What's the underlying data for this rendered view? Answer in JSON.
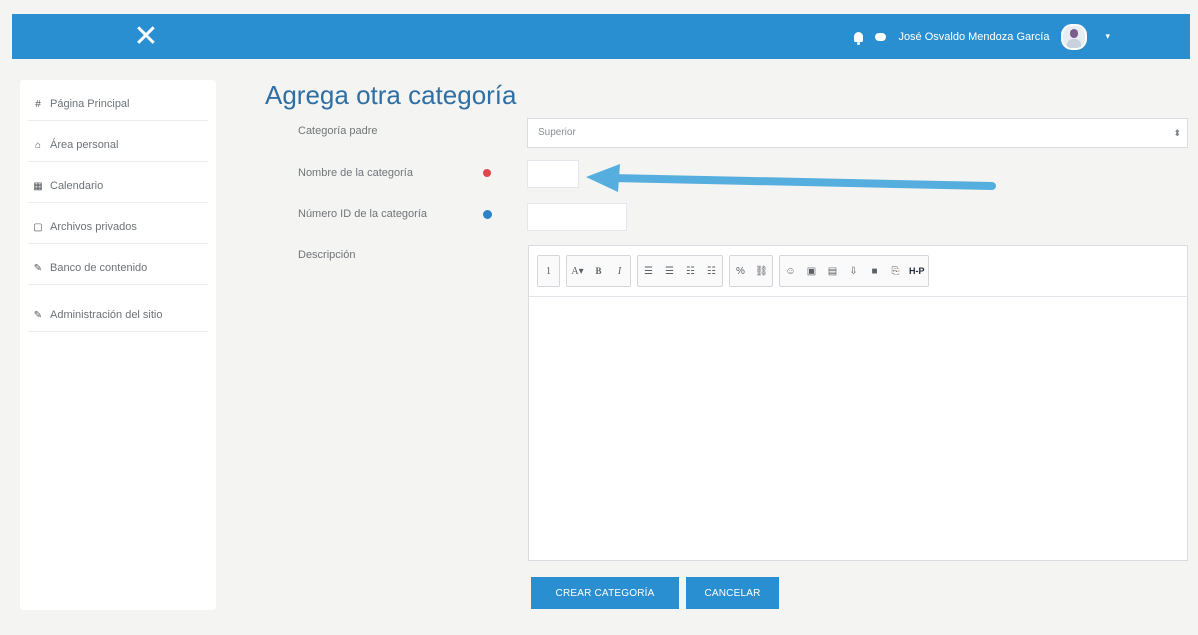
{
  "navbar": {
    "close_symbol": "✕",
    "user_name": "José Osvaldo Mendoza García",
    "caret": "▾",
    "icons": [
      "bell-icon",
      "chat-icon"
    ],
    "accent_color": "#2a8fd0"
  },
  "sidebar": {
    "items": [
      {
        "label": "Página Principal",
        "icon": "home-icon",
        "glyph": "#"
      },
      {
        "label": "Área personal",
        "icon": "dashboard-icon",
        "glyph": "⌂"
      },
      {
        "label": "Calendario",
        "icon": "calendar-icon",
        "glyph": "▦"
      },
      {
        "label": "Archivos privados",
        "icon": "file-icon",
        "glyph": "▢"
      },
      {
        "label": "Banco de contenido",
        "icon": "pencil-icon",
        "glyph": "✎"
      },
      {
        "label": "Administración del sitio",
        "icon": "wrench-icon",
        "glyph": "✎"
      }
    ]
  },
  "page": {
    "title": "Agrega otra categoría"
  },
  "form": {
    "parent_label": "Categoría padre",
    "parent_value": "Superior",
    "parent_chevron": "⬍",
    "name_label": "Nombre de la categoría",
    "name_value": "",
    "id_label": "Número ID de la categoría",
    "id_value": "",
    "description_label": "Descripción"
  },
  "editor": {
    "toolbar": [
      [
        "1"
      ],
      [
        "A▾",
        "B",
        "I"
      ],
      [
        "☰",
        "☰",
        "☷",
        "☷"
      ],
      [
        "%",
        "⛓"
      ],
      [
        "☺",
        "▣",
        "▤",
        "⇩",
        "■",
        "⎘",
        "H-P"
      ]
    ]
  },
  "buttons": {
    "create": "CREAR CATEGORÍA",
    "cancel": "CANCELAR"
  }
}
